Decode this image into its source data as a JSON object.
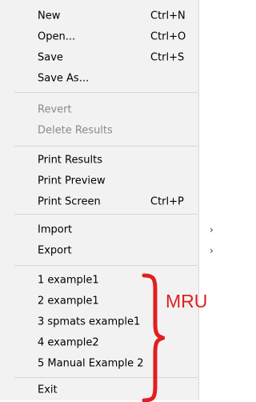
{
  "menu": {
    "new": {
      "label": "New",
      "shortcut": "Ctrl+N"
    },
    "open": {
      "label": "Open...",
      "shortcut": "Ctrl+O"
    },
    "save": {
      "label": "Save",
      "shortcut": "Ctrl+S"
    },
    "save_as": {
      "label": "Save As..."
    },
    "revert": {
      "label": "Revert"
    },
    "delete_results": {
      "label": "Delete Results"
    },
    "print_results": {
      "label": "Print Results"
    },
    "print_preview": {
      "label": "Print Preview"
    },
    "print_screen": {
      "label": "Print Screen",
      "shortcut": "Ctrl+P"
    },
    "import": {
      "label": "Import",
      "submenu_icon": "chevron-right-icon"
    },
    "export": {
      "label": "Export",
      "submenu_icon": "chevron-right-icon"
    },
    "mru": [
      {
        "label": "1 example1"
      },
      {
        "label": "2 example1"
      },
      {
        "label": "3 spmats example1"
      },
      {
        "label": "4 example2"
      },
      {
        "label": "5 Manual Example 2"
      }
    ],
    "exit": {
      "label": "Exit"
    }
  },
  "annotation": {
    "text": "MRU",
    "color": "#e01f1f",
    "brace_icon": "curly-brace-icon"
  }
}
